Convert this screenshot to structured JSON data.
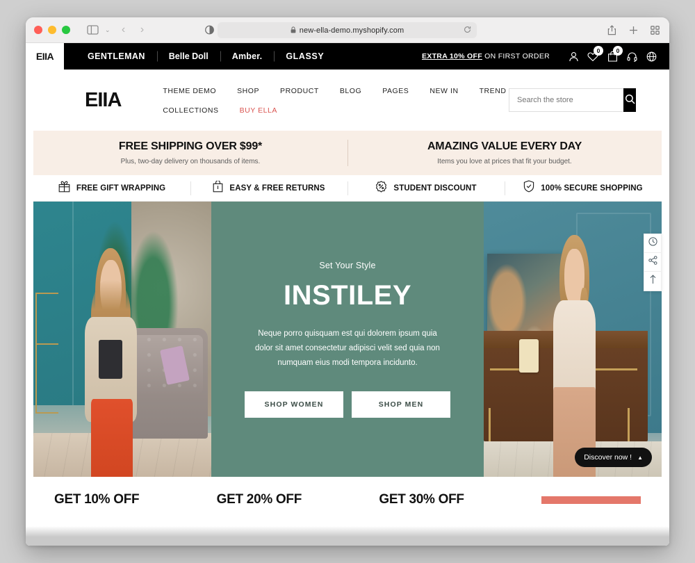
{
  "browser": {
    "url": "new-ella-demo.myshopify.com",
    "lock_icon": "lock-icon",
    "reload_icon": "reload-icon",
    "back_label": "‹",
    "forward_label": "›",
    "sidebar_icon": "sidebar-toggle-icon",
    "chevron_label": "⌄",
    "reader_icon": "reader-mode-icon",
    "share_icon": "share-icon",
    "newtab_icon": "new-tab-icon",
    "tabs_icon": "tab-overview-icon"
  },
  "topbar": {
    "logo": "EIIA",
    "brands": [
      {
        "label": "GENTLEMAN"
      },
      {
        "label": "Belle Doll"
      },
      {
        "label": "Amber."
      },
      {
        "label": "GLASSY"
      }
    ],
    "promo_highlight": "EXTRA 10% OFF",
    "promo_rest": " ON FIRST ORDER",
    "icons": {
      "account": "user-icon",
      "wishlist": "heart-icon",
      "wishlist_count": "0",
      "cart": "bag-icon",
      "cart_count": "0",
      "support": "headset-icon",
      "language": "globe-icon"
    }
  },
  "header": {
    "logo": "EIIA",
    "nav_row1": [
      {
        "label": "THEME DEMO"
      },
      {
        "label": "SHOP"
      },
      {
        "label": "PRODUCT"
      },
      {
        "label": "BLOG"
      },
      {
        "label": "PAGES"
      },
      {
        "label": "NEW IN"
      },
      {
        "label": "TREND"
      }
    ],
    "nav_row2": [
      {
        "label": "COLLECTIONS",
        "accent": false
      },
      {
        "label": "BUY ELLA",
        "accent": true
      }
    ],
    "search": {
      "placeholder": "Search the store",
      "value": "",
      "icon": "search-icon"
    }
  },
  "value_bar": {
    "background": "#f8eee6",
    "items": [
      {
        "title": "FREE SHIPPING OVER $99*",
        "subtitle": "Plus, two-day delivery on thousands of items."
      },
      {
        "title": "AMAZING VALUE EVERY DAY",
        "subtitle": "Items you love at prices that fit your budget."
      }
    ]
  },
  "features": [
    {
      "label": "FREE GIFT WRAPPING",
      "icon": "gift-icon"
    },
    {
      "label": "EASY & FREE RETURNS",
      "icon": "return-box-icon"
    },
    {
      "label": "STUDENT DISCOUNT",
      "icon": "percent-badge-icon"
    },
    {
      "label": "100% SECURE SHOPPING",
      "icon": "shield-icon"
    }
  ],
  "hero": {
    "background": "#5f8a7c",
    "eyebrow": "Set Your Style",
    "title": "INSTILEY",
    "description": "Neque porro quisquam est qui dolorem ipsum quia dolor sit amet consectetur adipisci velit sed quia non numquam eius modi tempora incidunto.",
    "buttons": [
      {
        "label": "SHOP WOMEN"
      },
      {
        "label": "SHOP MEN"
      }
    ],
    "left_image_alt": "Woman in beige shirt and orange trousers in teal living room",
    "right_image_alt": "Woman in cream top and tan skirt beside wooden desk"
  },
  "discover": {
    "label": "Discover now !",
    "caret": "▲"
  },
  "sidetools": [
    {
      "icon": "recently-viewed-icon"
    },
    {
      "icon": "share-icon"
    },
    {
      "icon": "back-to-top-icon"
    }
  ],
  "promo_strip": {
    "items": [
      {
        "label": "GET 10% OFF"
      },
      {
        "label": "GET 20% OFF"
      },
      {
        "label": "GET 30% OFF"
      }
    ],
    "button_color": "#e4776a"
  }
}
